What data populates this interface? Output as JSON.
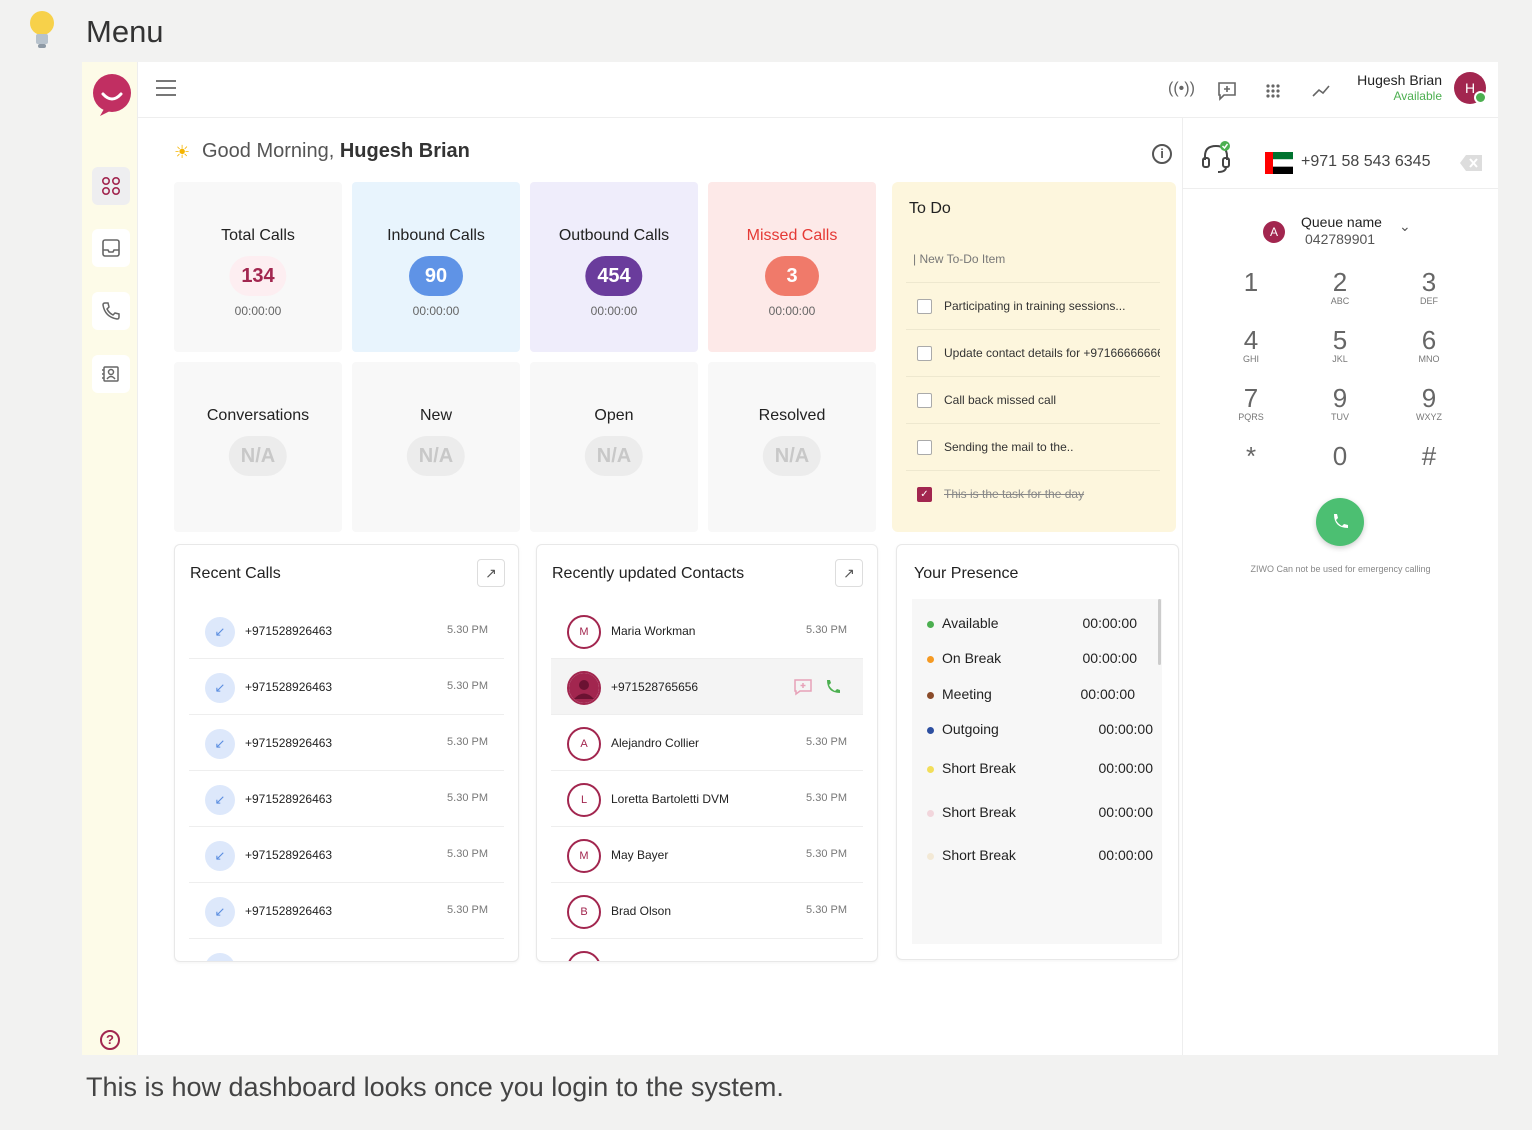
{
  "page": {
    "title": "Menu",
    "caption": "This is how dashboard looks once you login to the system."
  },
  "header": {
    "user_name": "Hugesh Brian",
    "user_status": "Available",
    "avatar_initial": "H"
  },
  "greeting": {
    "prefix": "Good Morning,",
    "name": "Hugesh Brian"
  },
  "stats": [
    {
      "label": "Total Calls",
      "value": "134",
      "time": "00:00:00"
    },
    {
      "label": "Inbound Calls",
      "value": "90",
      "time": "00:00:00"
    },
    {
      "label": "Outbound Calls",
      "value": "454",
      "time": "00:00:00"
    },
    {
      "label": "Missed Calls",
      "value": "3",
      "time": "00:00:00"
    },
    {
      "label": "Conversations",
      "value": "N/A"
    },
    {
      "label": "New",
      "value": "N/A"
    },
    {
      "label": "Open",
      "value": "N/A"
    },
    {
      "label": "Resolved",
      "value": "N/A"
    }
  ],
  "todo": {
    "title": "To Do",
    "placeholder": "| New To-Do Item",
    "items": [
      {
        "text": "Participating in training sessions...",
        "done": false
      },
      {
        "text": "Update contact details for +97166666666",
        "done": false
      },
      {
        "text": "Call back missed call",
        "done": false
      },
      {
        "text": "Sending the mail  to the..",
        "done": false
      },
      {
        "text": "This is the task for the day",
        "done": true
      }
    ]
  },
  "recent_calls": {
    "title": "Recent Calls",
    "items": [
      {
        "number": "+971528926463",
        "time": "5.30 PM"
      },
      {
        "number": "+971528926463",
        "time": "5.30 PM"
      },
      {
        "number": "+971528926463",
        "time": "5.30 PM"
      },
      {
        "number": "+971528926463",
        "time": "5.30 PM"
      },
      {
        "number": "+971528926463",
        "time": "5.30 PM"
      },
      {
        "number": "+971528926463",
        "time": "5.30 PM"
      }
    ]
  },
  "contacts": {
    "title": "Recently updated Contacts",
    "items": [
      {
        "initial": "M",
        "name": "Maria Workman",
        "time": "5.30 PM"
      },
      {
        "initial": "",
        "name": "+971528765656",
        "time": ""
      },
      {
        "initial": "A",
        "name": "Alejandro Collier",
        "time": "5.30 PM"
      },
      {
        "initial": "L",
        "name": "Loretta Bartoletti DVM",
        "time": "5.30 PM"
      },
      {
        "initial": "M",
        "name": "May Bayer",
        "time": "5.30 PM"
      },
      {
        "initial": "B",
        "name": "Brad Olson",
        "time": "5.30 PM"
      }
    ]
  },
  "presence": {
    "title": "Your Presence",
    "items": [
      {
        "label": "Available",
        "time": "00:00:00",
        "color": "#4caf50"
      },
      {
        "label": "On Break",
        "time": "00:00:00",
        "color": "#f59a23"
      },
      {
        "label": "Meeting",
        "time": "00:00:00",
        "color": "#8a4b2a"
      },
      {
        "label": "Outgoing",
        "time": "00:00:00",
        "color": "#2d4fa0"
      },
      {
        "label": "Short Break",
        "time": "00:00:00",
        "color": "#f2de5a"
      },
      {
        "label": "Short Break",
        "time": "00:00:00",
        "color": "#f2d6dc"
      },
      {
        "label": "Short Break",
        "time": "00:00:00",
        "color": "#f3e9d6"
      }
    ]
  },
  "dialer": {
    "phone": "+971 58 543 6345",
    "queue_name": "Queue name",
    "queue_number": "042789901",
    "queue_initial": "A",
    "keys": [
      {
        "d": "1",
        "l": ""
      },
      {
        "d": "2",
        "l": "ABC"
      },
      {
        "d": "3",
        "l": "DEF"
      },
      {
        "d": "4",
        "l": "GHI"
      },
      {
        "d": "5",
        "l": "JKL"
      },
      {
        "d": "6",
        "l": "MNO"
      },
      {
        "d": "7",
        "l": "PQRS"
      },
      {
        "d": "9",
        "l": "TUV"
      },
      {
        "d": "9",
        "l": "WXYZ"
      },
      {
        "d": "*",
        "l": ""
      },
      {
        "d": "0",
        "l": ""
      },
      {
        "d": "#",
        "l": ""
      }
    ],
    "notice": "ZIWO Can not be used for emergency calling"
  },
  "colors": {
    "brand": "#a2264f",
    "green": "#4caf50",
    "missed": "#e53935"
  }
}
